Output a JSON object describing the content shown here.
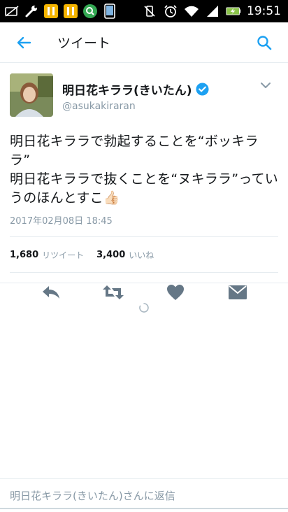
{
  "status_bar": {
    "time": "19:51",
    "left_icons": [
      "sim-off-icon",
      "wrench-icon",
      "pause-app-icon",
      "pause-app-icon",
      "search-app-icon",
      "phone-icon"
    ],
    "right_icons": [
      "vibrate-off-icon",
      "alarm-icon",
      "wifi-icon",
      "signal-icon",
      "battery-charging-icon"
    ]
  },
  "app_bar": {
    "title": "ツイート"
  },
  "tweet": {
    "display_name": "明日花キララ(きいたん)",
    "handle": "@asukakiraran",
    "text_lines": [
      "明日花キララで勃起することを“ボッキララ”",
      "明日花キララで抜くことを“ヌキララ”ってい",
      "うのほんとすこ👍🏻"
    ],
    "timestamp": "2017年02月08日 18:45",
    "retweets": "1,680",
    "retweets_label": "リツイート",
    "likes": "3,400",
    "likes_label": "いいね"
  },
  "reply": {
    "placeholder": "明日花キララ(きいたん)さんに返信"
  },
  "colors": {
    "accent": "#1da1f2",
    "icon_gray": "#657786",
    "text": "#14171a",
    "muted": "#8899a6"
  }
}
